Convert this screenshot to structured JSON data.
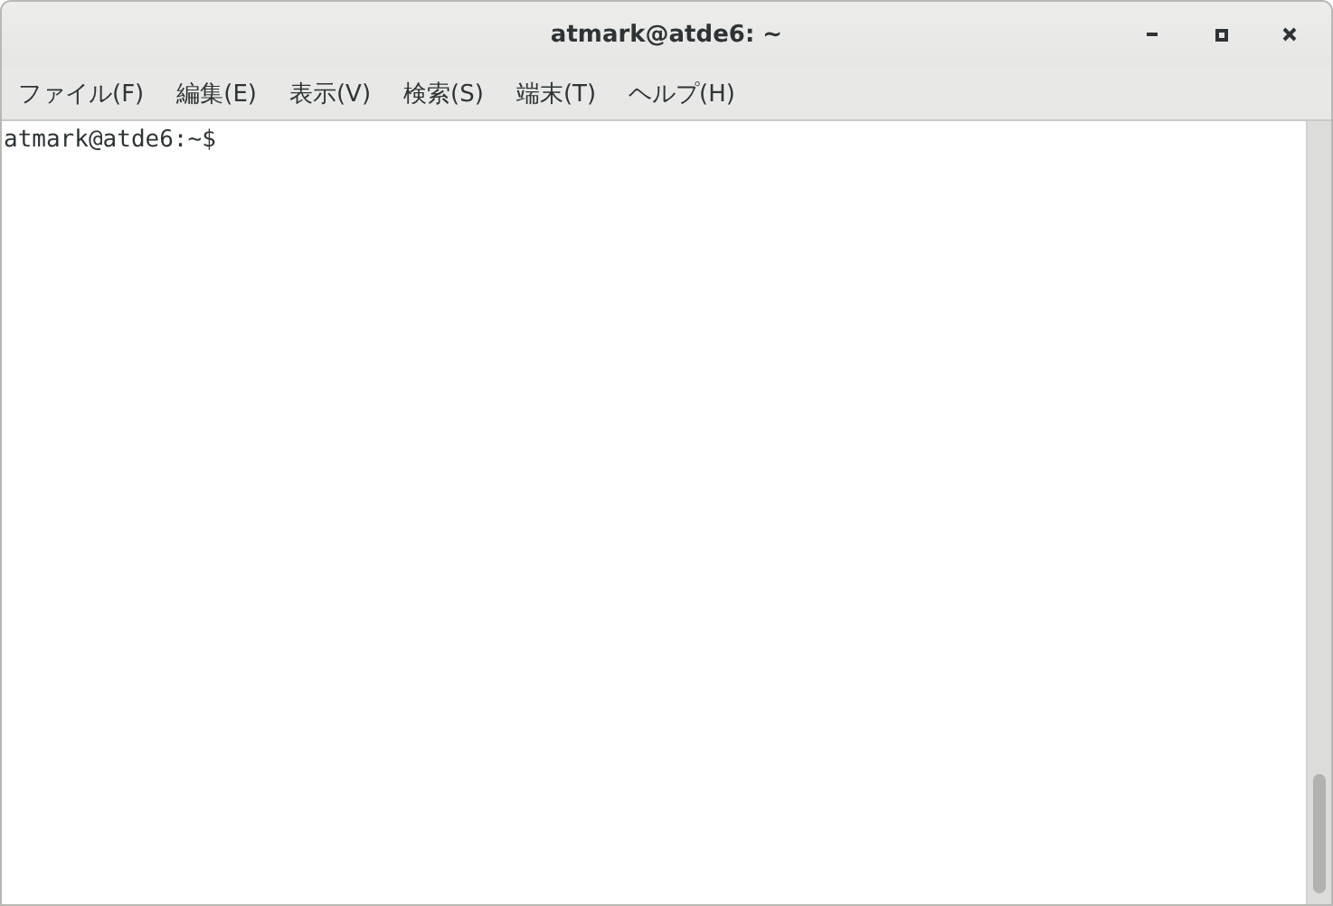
{
  "window": {
    "title": "atmark@atde6: ~"
  },
  "menu": [
    {
      "label": "ファイル(F)"
    },
    {
      "label": "編集(E)"
    },
    {
      "label": "表示(V)"
    },
    {
      "label": "検索(S)"
    },
    {
      "label": "端末(T)"
    },
    {
      "label": "ヘルプ(H)"
    }
  ],
  "terminal": {
    "lines": [
      "atmark@atde6:~$"
    ]
  }
}
